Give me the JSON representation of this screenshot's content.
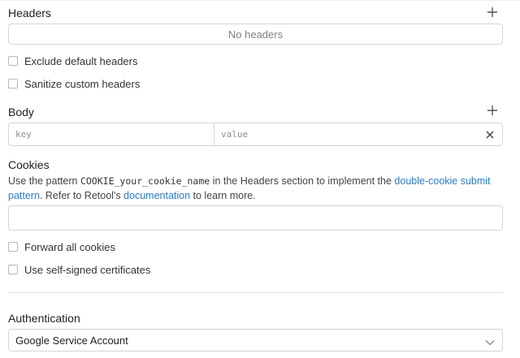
{
  "headers": {
    "title": "Headers",
    "empty_text": "No headers"
  },
  "options": {
    "exclude_default_headers": "Exclude default headers",
    "sanitize_custom_headers": "Sanitize custom headers"
  },
  "body": {
    "title": "Body",
    "key_placeholder": "key",
    "value_placeholder": "value"
  },
  "cookies": {
    "title": "Cookies",
    "desc_part1": "Use the pattern ",
    "desc_code": "COOKIE_your_cookie_name",
    "desc_part2": " in the Headers section to implement the ",
    "desc_link1": "double-cookie submit pattern",
    "desc_part3": ". Refer to Retool's ",
    "desc_link2": "documentation",
    "desc_part4": " to learn more.",
    "input_value": ""
  },
  "more_options": {
    "forward_all_cookies": "Forward all cookies",
    "use_self_signed_certificates": "Use self-signed certificates"
  },
  "authentication": {
    "title": "Authentication",
    "selected": "Google Service Account"
  },
  "icons": {
    "add": "plus-icon",
    "remove": "close-icon",
    "dropdown": "chevron-down-icon"
  },
  "colors": {
    "link": "#2b7bd0",
    "border": "#d6d6d6"
  }
}
